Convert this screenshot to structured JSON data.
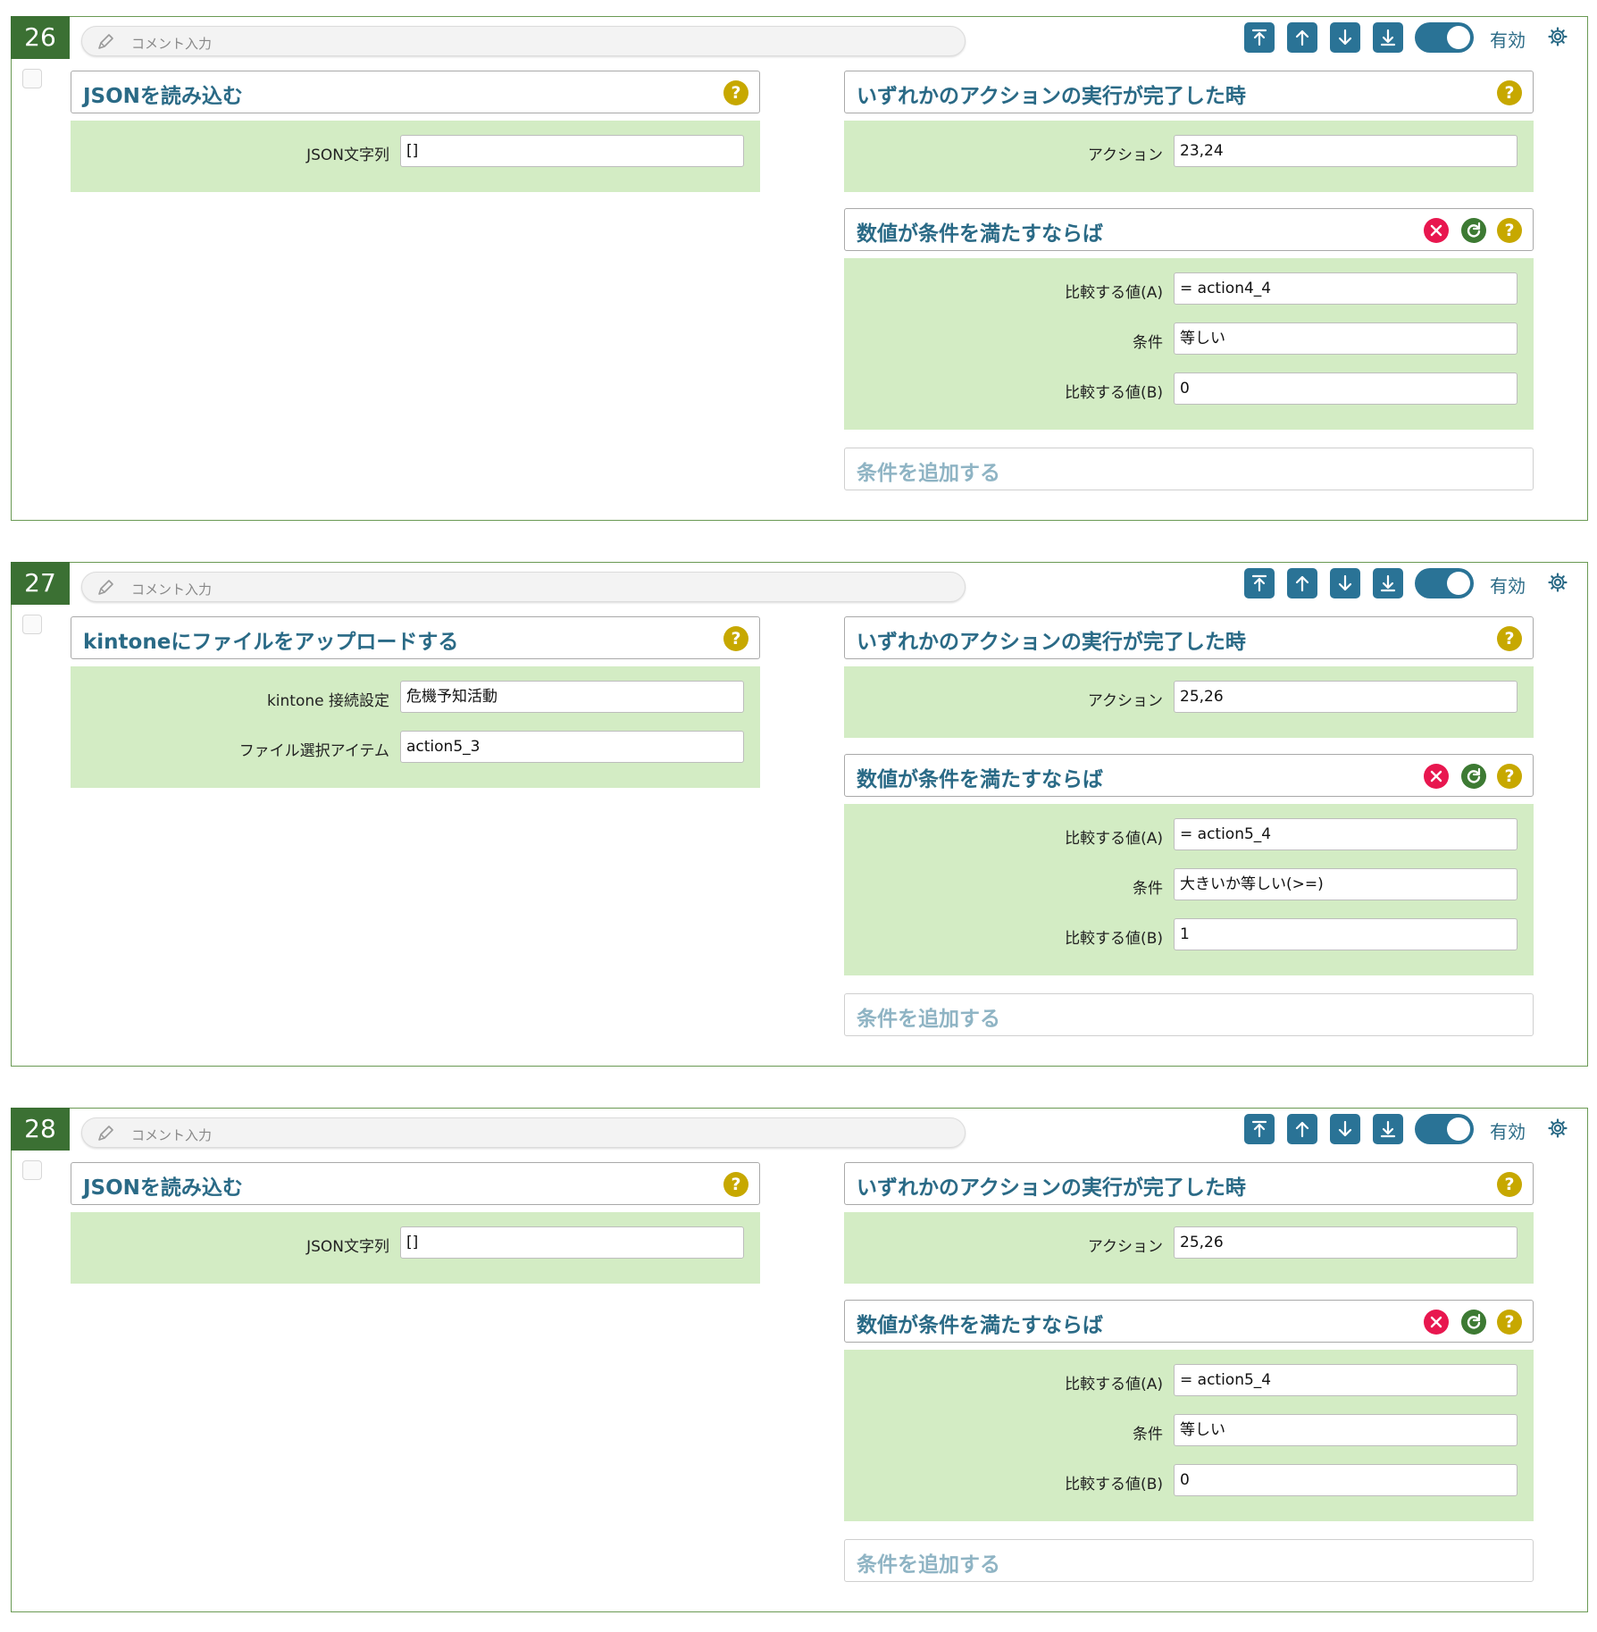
{
  "common": {
    "comment_placeholder": "コメント入力",
    "enabled_label": "有効",
    "add_condition_label": "条件を追加する",
    "icons": [
      "pencil-icon",
      "move-top-icon",
      "move-up-icon",
      "move-down-icon",
      "move-bottom-icon",
      "gear-icon",
      "help-icon",
      "delete-icon",
      "refresh-icon"
    ],
    "colors": {
      "step_number_bg": "#3b7033",
      "accent": "#2a7396",
      "field_bg": "#d3ecc4",
      "help": "#c7a800",
      "delete": "#e8174f",
      "refresh": "#3d7a33",
      "title": "#2a6a86"
    }
  },
  "blocks": [
    {
      "number": "26",
      "action": {
        "title": "JSONを読み込む",
        "fields": [
          {
            "label": "JSON文字列",
            "value": "[]"
          }
        ]
      },
      "trigger": {
        "title": "いずれかのアクションの実行が完了した時",
        "fields": [
          {
            "label": "アクション",
            "value": "23,24"
          }
        ]
      },
      "condition": {
        "title": "数値が条件を満たすならば",
        "fields": [
          {
            "label": "比較する値(A)",
            "value": "= action4_4"
          },
          {
            "label": "条件",
            "value": "等しい"
          },
          {
            "label": "比較する値(B)",
            "value": "0"
          }
        ]
      }
    },
    {
      "number": "27",
      "action": {
        "title": "kintoneにファイルをアップロードする",
        "fields": [
          {
            "label": "kintone 接続設定",
            "value": "危機予知活動"
          },
          {
            "label": "ファイル選択アイテム",
            "value": "action5_3"
          }
        ]
      },
      "trigger": {
        "title": "いずれかのアクションの実行が完了した時",
        "fields": [
          {
            "label": "アクション",
            "value": "25,26"
          }
        ]
      },
      "condition": {
        "title": "数値が条件を満たすならば",
        "fields": [
          {
            "label": "比較する値(A)",
            "value": "= action5_4"
          },
          {
            "label": "条件",
            "value": "大きいか等しい(>=)"
          },
          {
            "label": "比較する値(B)",
            "value": "1"
          }
        ]
      }
    },
    {
      "number": "28",
      "action": {
        "title": "JSONを読み込む",
        "fields": [
          {
            "label": "JSON文字列",
            "value": "[]"
          }
        ]
      },
      "trigger": {
        "title": "いずれかのアクションの実行が完了した時",
        "fields": [
          {
            "label": "アクション",
            "value": "25,26"
          }
        ]
      },
      "condition": {
        "title": "数値が条件を満たすならば",
        "fields": [
          {
            "label": "比較する値(A)",
            "value": "= action5_4"
          },
          {
            "label": "条件",
            "value": "等しい"
          },
          {
            "label": "比較する値(B)",
            "value": "0"
          }
        ]
      }
    }
  ]
}
